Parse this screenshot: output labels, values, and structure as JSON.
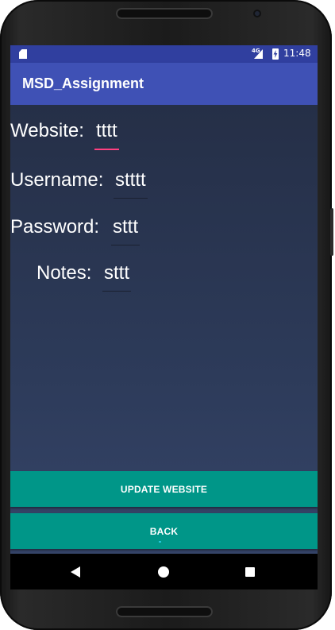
{
  "status_bar": {
    "network_type": "4G",
    "time": "11:48",
    "icons": [
      "sd-card-icon",
      "signal-icon",
      "battery-charging-icon"
    ]
  },
  "app_bar": {
    "title": "MSD_Assignment"
  },
  "form": {
    "website": {
      "label": "Website:",
      "value": "tttt"
    },
    "username": {
      "label": "Username:",
      "value": "stttt"
    },
    "password": {
      "label": "Password:",
      "value": "sttt"
    },
    "notes": {
      "label": "Notes:",
      "value": "sttt"
    }
  },
  "buttons": {
    "update_label": "UPDATE WEBSITE",
    "back_label": "BACK"
  },
  "nav_bar": {
    "icons": [
      "back-triangle-icon",
      "home-circle-icon",
      "recents-square-icon"
    ]
  },
  "colors": {
    "status_bar": "#303f9f",
    "app_bar": "#3f51b5",
    "accent": "#ff4081",
    "button": "#009688",
    "background_top": "#252f47",
    "background_bottom": "#354468"
  }
}
